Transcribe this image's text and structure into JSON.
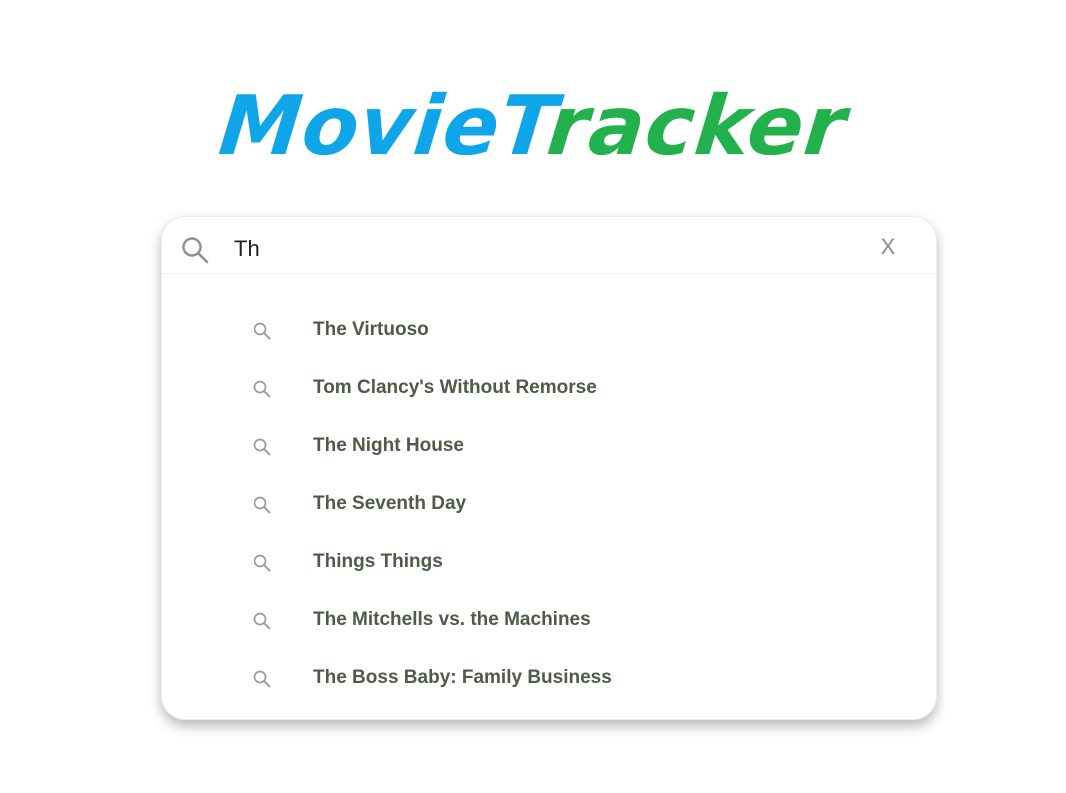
{
  "app": {
    "logo": {
      "part1": "Movie",
      "part2_first": "T",
      "part2_rest": "racker"
    }
  },
  "colors": {
    "logo_blue": "#0ea5e9",
    "logo_green": "#22b14c",
    "suggestion_text": "#4f5a4a",
    "icon_gray": "#9a9a9a"
  },
  "search": {
    "value": "Th",
    "clear_label": "X",
    "icon": "search-icon"
  },
  "suggestions": [
    {
      "label": "The Virtuoso",
      "icon": "search-icon"
    },
    {
      "label": "Tom Clancy's Without Remorse",
      "icon": "search-icon"
    },
    {
      "label": "The Night House",
      "icon": "search-icon"
    },
    {
      "label": "The Seventh Day",
      "icon": "search-icon"
    },
    {
      "label": "Things Things",
      "icon": "search-icon"
    },
    {
      "label": "The Mitchells vs. the Machines",
      "icon": "search-icon"
    },
    {
      "label": "The Boss Baby: Family Business",
      "icon": "search-icon"
    }
  ]
}
